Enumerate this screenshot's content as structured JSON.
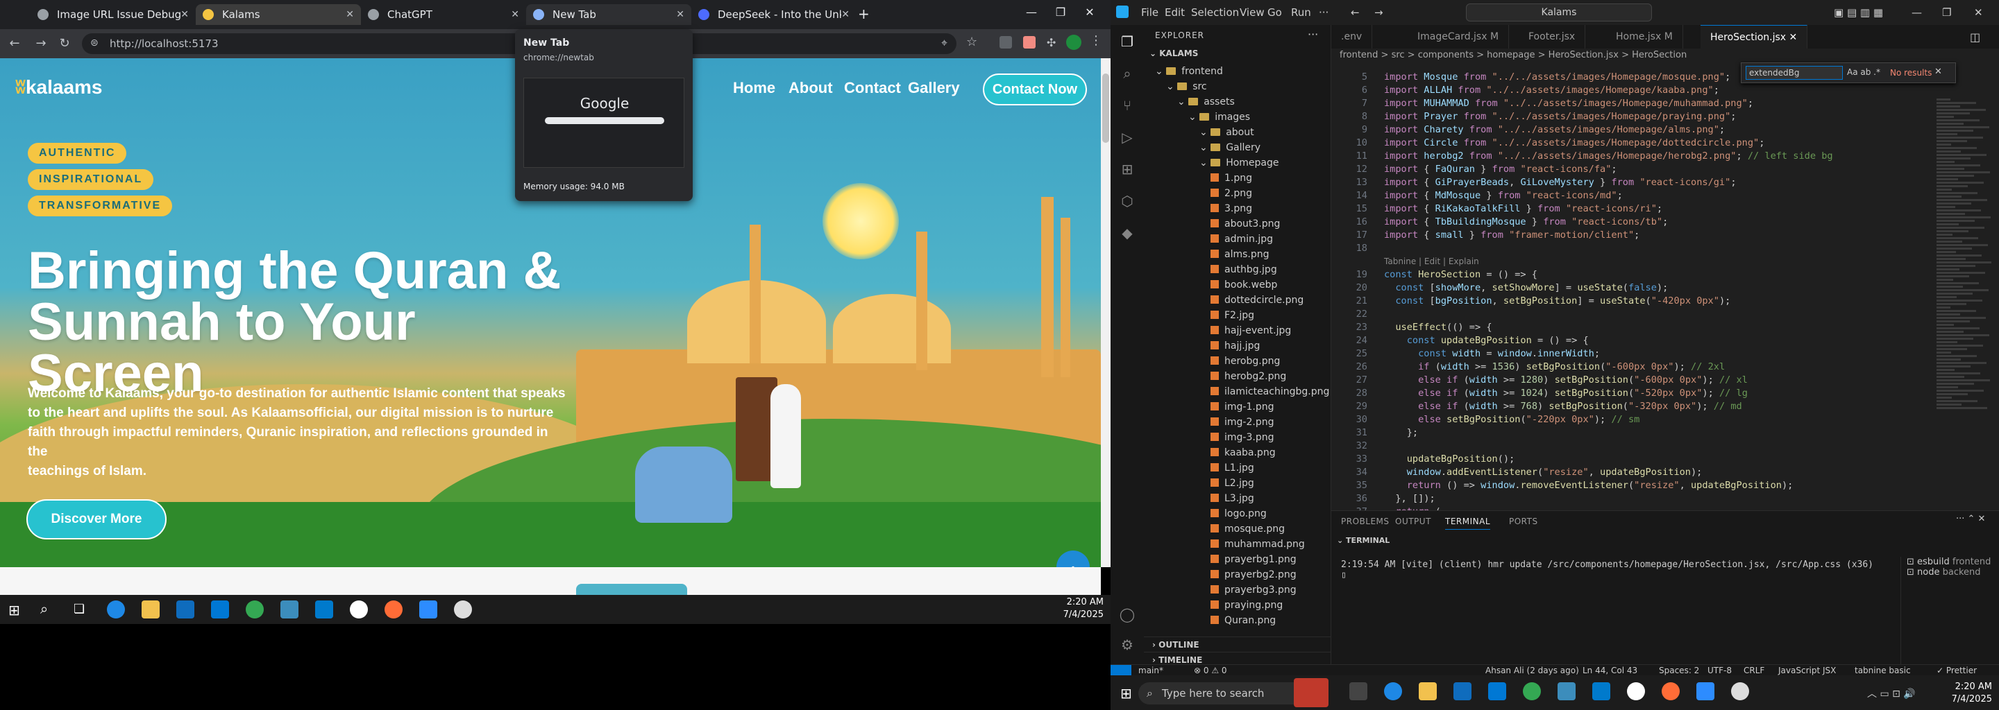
{
  "browser": {
    "tabs": [
      {
        "label": "Image URL Issue Debugging",
        "close": "✕"
      },
      {
        "label": "Kalams",
        "close": "✕"
      },
      {
        "label": "ChatGPT",
        "close": "✕"
      },
      {
        "label": "New Tab",
        "close": "✕"
      },
      {
        "label": "DeepSeek - Into the Unknown",
        "close": "✕"
      }
    ],
    "new_tab_symbol": "+",
    "url": "http://localhost:5173",
    "preview": {
      "title": "New Tab",
      "url": "chrome://newtab",
      "google": "Google",
      "memory": "Memory usage: 94.0 MB"
    }
  },
  "site": {
    "logo": "kalaams",
    "nav": [
      "Home",
      "About",
      "Contact",
      "Gallery"
    ],
    "contact_button": "Contact Now",
    "badges": [
      "AUTHENTIC",
      "INSPIRATIONAL",
      "TRANSFORMATIVE"
    ],
    "hero_title_1": "Bringing the Quran &",
    "hero_title_2": "Sunnah to Your Screen",
    "para_1": "Welcome to Kalaams, your go-to destination for authentic Islamic content that speaks",
    "para_2": "to the heart and uplifts the soul. As Kalaamsofficial, our digital mission is to nurture",
    "para_3": "faith through impactful reminders, Quranic inspiration, and reflections grounded in the",
    "para_4": "teachings of Islam.",
    "discover_button": "Discover More"
  },
  "taskbar_left": {
    "time": "2:20 AM",
    "date": "7/4/2025"
  },
  "vscode": {
    "menu": [
      "File",
      "Edit",
      "Selection",
      "View",
      "Go",
      "Run"
    ],
    "command_center": "Kalams",
    "explorer_title": "EXPLORER",
    "root": "KALAMS",
    "tree": [
      {
        "d": 1,
        "type": "folder",
        "name": "frontend"
      },
      {
        "d": 2,
        "type": "folder",
        "name": "src"
      },
      {
        "d": 3,
        "type": "folder",
        "name": "assets"
      },
      {
        "d": 4,
        "type": "folder",
        "name": "images"
      },
      {
        "d": 5,
        "type": "folder",
        "name": "about"
      },
      {
        "d": 5,
        "type": "folder",
        "name": "Gallery"
      },
      {
        "d": 5,
        "type": "folder",
        "name": "Homepage"
      },
      {
        "d": 6,
        "type": "file",
        "name": "1.png"
      },
      {
        "d": 6,
        "type": "file",
        "name": "2.png"
      },
      {
        "d": 6,
        "type": "file",
        "name": "3.png"
      },
      {
        "d": 6,
        "type": "file",
        "name": "about3.png"
      },
      {
        "d": 6,
        "type": "file",
        "name": "admin.jpg"
      },
      {
        "d": 6,
        "type": "file",
        "name": "alms.png"
      },
      {
        "d": 6,
        "type": "file",
        "name": "authbg.jpg"
      },
      {
        "d": 6,
        "type": "file",
        "name": "book.webp"
      },
      {
        "d": 6,
        "type": "file",
        "name": "dottedcircle.png"
      },
      {
        "d": 6,
        "type": "file",
        "name": "F2.jpg"
      },
      {
        "d": 6,
        "type": "file",
        "name": "hajj-event.jpg"
      },
      {
        "d": 6,
        "type": "file",
        "name": "hajj.jpg"
      },
      {
        "d": 6,
        "type": "file",
        "name": "herobg.png"
      },
      {
        "d": 6,
        "type": "file",
        "name": "herobg2.png"
      },
      {
        "d": 6,
        "type": "file",
        "name": "ilamicteachingbg.png"
      },
      {
        "d": 6,
        "type": "file",
        "name": "img-1.png"
      },
      {
        "d": 6,
        "type": "file",
        "name": "img-2.png"
      },
      {
        "d": 6,
        "type": "file",
        "name": "img-3.png"
      },
      {
        "d": 6,
        "type": "file",
        "name": "kaaba.png"
      },
      {
        "d": 6,
        "type": "file",
        "name": "L1.jpg"
      },
      {
        "d": 6,
        "type": "file",
        "name": "L2.jpg"
      },
      {
        "d": 6,
        "type": "file",
        "name": "L3.jpg"
      },
      {
        "d": 6,
        "type": "file",
        "name": "logo.png"
      },
      {
        "d": 6,
        "type": "file",
        "name": "mosque.png"
      },
      {
        "d": 6,
        "type": "file",
        "name": "muhammad.png"
      },
      {
        "d": 6,
        "type": "file",
        "name": "prayerbg1.png"
      },
      {
        "d": 6,
        "type": "file",
        "name": "prayerbg2.png"
      },
      {
        "d": 6,
        "type": "file",
        "name": "prayerbg3.png"
      },
      {
        "d": 6,
        "type": "file",
        "name": "praying.png"
      },
      {
        "d": 6,
        "type": "file",
        "name": "Quran.png"
      }
    ],
    "outline": "OUTLINE",
    "timeline": "TIMELINE",
    "editor_tabs": [
      {
        "label": ".env"
      },
      {
        "label": "ImageCard.jsx M"
      },
      {
        "label": "Footer.jsx"
      },
      {
        "label": "Home.jsx M"
      },
      {
        "label": "HeroSection.jsx"
      }
    ],
    "breadcrumb": "frontend > src > components > homepage > HeroSection.jsx > HeroSection",
    "find": {
      "value": "extendedBg",
      "result": "No results"
    },
    "code_lens": "Tabnine | Edit | Explain",
    "panel_tabs": [
      "PROBLEMS",
      "OUTPUT",
      "TERMINAL",
      "PORTS"
    ],
    "terminal_label": "TERMINAL",
    "terminal_line": "2:19:54 AM [vite] (client) hmr update /src/components/homepage/HeroSection.jsx, /src/App.css (x36)",
    "terminals": [
      {
        "name": "esbuild",
        "sub": "frontend"
      },
      {
        "name": "node",
        "sub": "backend"
      }
    ],
    "status": {
      "branch": "main*",
      "errors": "⊗ 0 ⚠ 0",
      "blame": "Ahsan Ali (2 days ago)",
      "position": "Ln 44, Col 43",
      "spaces": "Spaces: 2",
      "encoding": "UTF-8",
      "eol": "CRLF",
      "language": "JavaScript JSX",
      "tabnine": "tabnine basic",
      "prettier": "✓ Prettier"
    }
  },
  "taskbar_right": {
    "search": "Type here to search",
    "time": "2:20 AM",
    "date": "7/4/2025"
  }
}
